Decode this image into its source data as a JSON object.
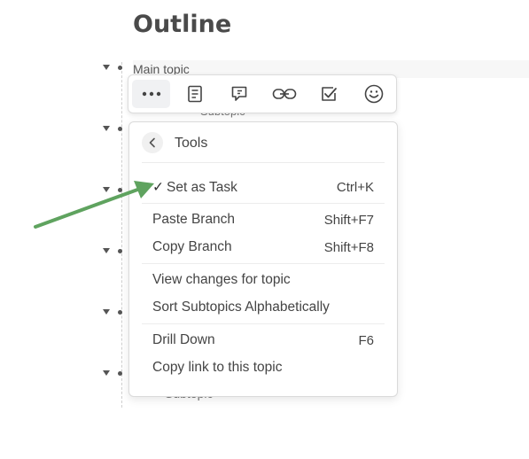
{
  "page": {
    "title": "Outline"
  },
  "outline": {
    "main_topic": "Main topic",
    "subtopic_partial": "Subtopic",
    "subtopic_bottom": "Subtopic",
    "rows": 6
  },
  "toolbar": {
    "items": [
      {
        "name": "more",
        "icon": "more-horizontal-icon"
      },
      {
        "name": "note",
        "icon": "note-icon"
      },
      {
        "name": "comment",
        "icon": "comment-icon"
      },
      {
        "name": "link",
        "icon": "link-icon"
      },
      {
        "name": "task",
        "icon": "checkbox-icon"
      },
      {
        "name": "emoji",
        "icon": "smiley-icon"
      }
    ]
  },
  "menu": {
    "header": "Tools",
    "items": [
      {
        "label": "Set as Task",
        "shortcut": "Ctrl+K",
        "checked": true
      },
      {
        "label": "Paste Branch",
        "shortcut": "Shift+F7"
      },
      {
        "label": "Copy Branch",
        "shortcut": "Shift+F8"
      },
      {
        "label": "View changes for topic",
        "shortcut": ""
      },
      {
        "label": "Sort Subtopics Alphabetically",
        "shortcut": ""
      },
      {
        "label": "Drill Down",
        "shortcut": "F6"
      },
      {
        "label": "Copy link to this topic",
        "shortcut": ""
      }
    ],
    "check_glyph": "✓"
  },
  "colors": {
    "arrow": "#5fa35f",
    "text": "#444444",
    "title": "#4a4a4a"
  }
}
